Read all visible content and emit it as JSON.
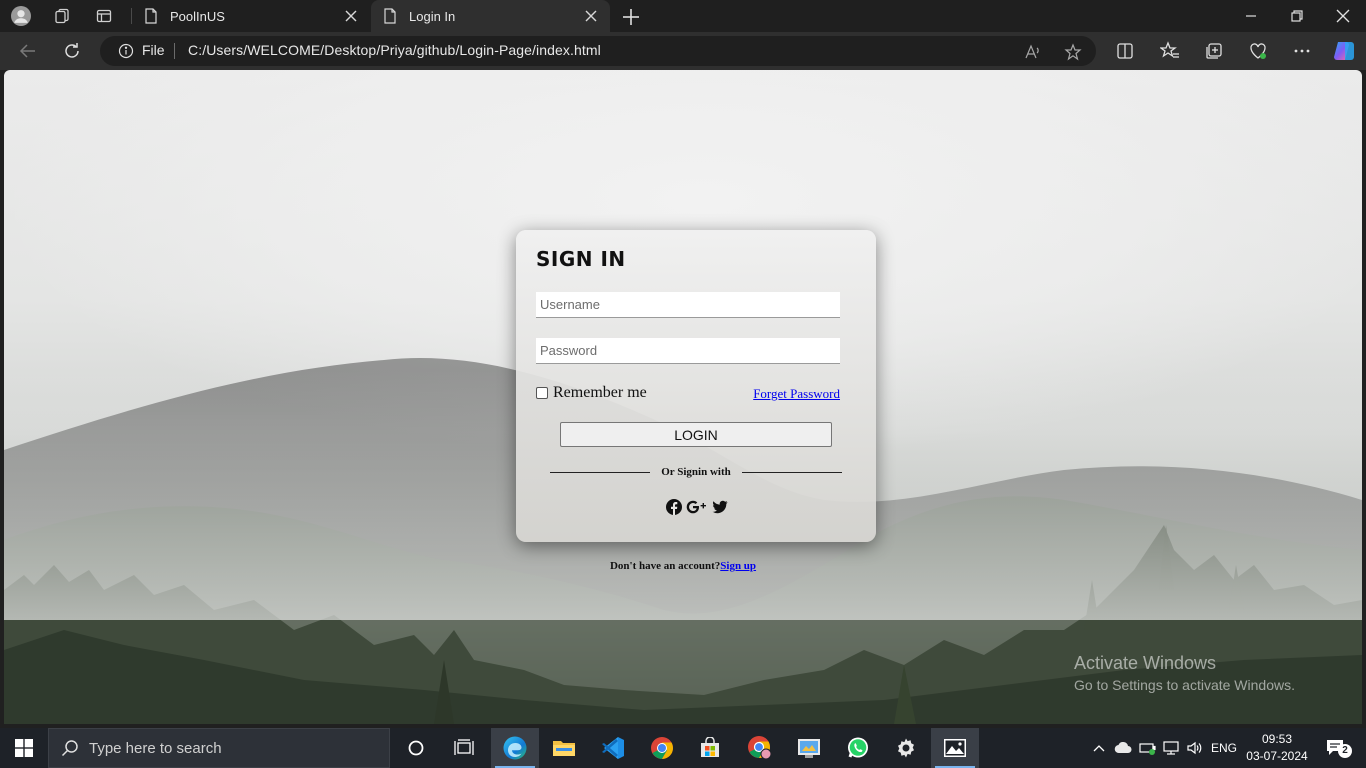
{
  "browser": {
    "tabs": [
      {
        "title": "PoolInUS",
        "active": false
      },
      {
        "title": "Login In",
        "active": true
      }
    ],
    "address": {
      "scheme_label": "File",
      "url": "C:/Users/WELCOME/Desktop/Priya/github/Login-Page/index.html"
    }
  },
  "login": {
    "title": "SIGN IN",
    "username_placeholder": "Username",
    "password_placeholder": "Password",
    "remember_label": "Remember me",
    "forget_label": "Forget Password",
    "login_button": "LOGIN",
    "or_text": "Or Signin with",
    "social_icons": [
      "facebook-icon",
      "google-plus-icon",
      "twitter-icon"
    ],
    "no_account_text": "Don't have an account?",
    "signup_link": "Sign up"
  },
  "watermark": {
    "line1": "Activate Windows",
    "line2": "Go to Settings to activate Windows."
  },
  "taskbar": {
    "search_placeholder": "Type here to search",
    "language": "ENG",
    "time": "09:53",
    "date": "03-07-2024",
    "notification_count": "2"
  },
  "colors": {
    "link": "#0000ee",
    "taskbar": "#1e2228",
    "browser_frame": "#1f1f1f"
  }
}
